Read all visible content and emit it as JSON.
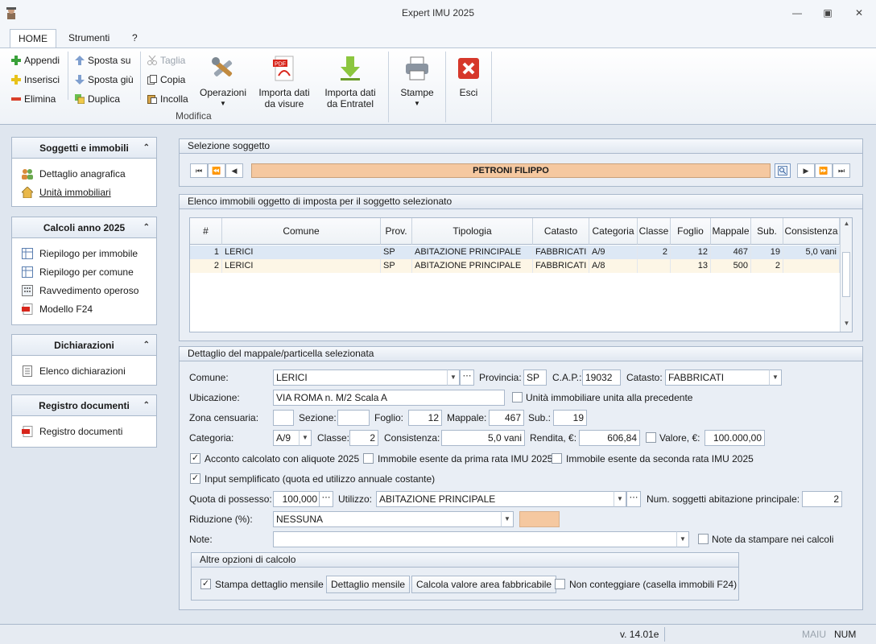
{
  "window": {
    "title": "Expert IMU 2025"
  },
  "menu": {
    "tabs": [
      "HOME",
      "Strumenti",
      "?"
    ]
  },
  "ribbon": {
    "appendi": "Appendi",
    "inserisci": "Inserisci",
    "elimina": "Elimina",
    "sposta_su": "Sposta su",
    "sposta_giu": "Sposta giù",
    "duplica": "Duplica",
    "taglia": "Taglia",
    "copia": "Copia",
    "incolla": "Incolla",
    "operazioni": "Operazioni",
    "importa_visure_1": "Importa dati",
    "importa_visure_2": "da visure",
    "importa_entratel_1": "Importa dati",
    "importa_entratel_2": "da Entratel",
    "group_label": "Modifica",
    "stampe": "Stampe",
    "esci": "Esci"
  },
  "sidebar": {
    "sections": [
      {
        "title": "Soggetti e immobili",
        "items": [
          "Dettaglio anagrafica",
          "Unità immobiliari"
        ]
      },
      {
        "title": "Calcoli anno 2025",
        "items": [
          "Riepilogo per immobile",
          "Riepilogo per comune",
          "Ravvedimento operoso",
          "Modello F24"
        ]
      },
      {
        "title": "Dichiarazioni",
        "items": [
          "Elenco dichiarazioni"
        ]
      },
      {
        "title": "Registro documenti",
        "items": [
          "Registro documenti"
        ]
      }
    ]
  },
  "selezione": {
    "title": "Selezione soggetto",
    "soggetto": "PETRONI FILIPPO"
  },
  "elenco": {
    "title": "Elenco immobili oggetto di imposta per il soggetto selezionato",
    "columns": [
      "#",
      "Comune",
      "Prov.",
      "Tipologia",
      "Catasto",
      "Categoria",
      "Classe",
      "Foglio",
      "Mappale",
      "Sub.",
      "Consistenza"
    ],
    "rows": [
      [
        "1",
        "LERICI",
        "SP",
        "ABITAZIONE PRINCIPALE",
        "FABBRICATI",
        "A/9",
        "2",
        "12",
        "467",
        "19",
        "5,0 vani"
      ],
      [
        "2",
        "LERICI",
        "SP",
        "ABITAZIONE PRINCIPALE",
        "FABBRICATI",
        "A/8",
        "",
        "13",
        "500",
        "2",
        ""
      ]
    ]
  },
  "dettaglio": {
    "title": "Dettaglio del mappale/particella selezionata",
    "comune_label": "Comune:",
    "comune": "LERICI",
    "provincia_label": "Provincia:",
    "provincia": "SP",
    "cap_label": "C.A.P.:",
    "cap": "19032",
    "catasto_label": "Catasto:",
    "catasto": "FABBRICATI",
    "ubicazione_label": "Ubicazione:",
    "ubicazione": "VIA ROMA n. M/2  Scala A",
    "unita_label": "Unità immobiliare unita alla precedente",
    "zona_label": "Zona censuaria:",
    "zona": "",
    "sezione_label": "Sezione:",
    "sezione": "",
    "foglio_label": "Foglio:",
    "foglio": "12",
    "mappale_label": "Mappale:",
    "mappale": "467",
    "sub_label": "Sub.:",
    "sub": "19",
    "categoria_label": "Categoria:",
    "categoria": "A/9",
    "classe_label": "Classe:",
    "classe": "2",
    "consistenza_label": "Consistenza:",
    "consistenza": "5,0 vani",
    "rendita_label": "Rendita, €:",
    "rendita": "606,84",
    "valore_label": "Valore, €:",
    "valore": "100.000,00",
    "acconto_label": "Acconto calcolato con aliquote 2025",
    "esente_prima_label": "Immobile esente da prima rata IMU 2025",
    "esente_seconda_label": "Immobile esente da seconda rata IMU 2025",
    "semplificato_label": "Input semplificato (quota ed utilizzo annuale costante)",
    "quota_label": "Quota di possesso:",
    "quota": "100,000",
    "utilizzo_label": "Utilizzo:",
    "utilizzo": "ABITAZIONE PRINCIPALE",
    "num_soggetti_label": "Num. soggetti abitazione principale:",
    "num_soggetti": "2",
    "riduzione_label": "Riduzione (%):",
    "riduzione": "NESSUNA",
    "note_label": "Note:",
    "note": "",
    "note_stampa_label": "Note da stampare nei calcoli",
    "altre_title": "Altre opzioni di calcolo",
    "stampa_mensile_label": "Stampa dettaglio mensile",
    "btn_dettaglio_mensile": "Dettaglio mensile",
    "btn_calcola_area": "Calcola valore area fabbricabile",
    "non_conteggiare_label": "Non conteggiare (casella immobili F24)"
  },
  "status": {
    "version": "v. 14.01e",
    "maiu": "MAIU",
    "num": "NUM"
  },
  "colors": {
    "accent": "#f5c8a0",
    "panel_border": "#a9b8cb",
    "selected_row": "#dde8f5"
  }
}
